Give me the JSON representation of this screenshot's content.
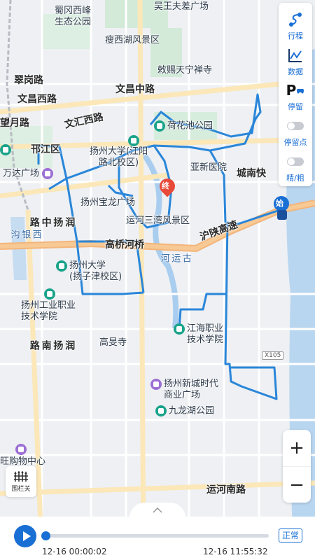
{
  "map": {
    "labels": {
      "shugang": "蜀冈西峰\n生态公园",
      "wuwang": "吴王夫差广场",
      "shouxihu": "瘦西湖风景区",
      "cuigang": "翠岗路",
      "chici": "敕赐天宁禅寺",
      "wenchangxi": "文昌西路",
      "wenchangzhong": "文昌中路",
      "wanghang": "望月路",
      "wenhuixi": "文汇西路",
      "hehuachi": "荷花池公园",
      "hanjiang": "邗江区",
      "yzu_jiangyang": "扬州大学(江阳\n路北校区)",
      "wanda": "万达广场",
      "yaxin": "亚新医院",
      "chengnan": "城南快",
      "baolong": "扬州宝龙广场",
      "yunhe_sanwan": "运河三湾风景区",
      "hushan": "沪陕高速",
      "xiyinyan": "西\n银\n沟",
      "runyang_zhong": "润\n扬\n中\n路",
      "gaoqiao": "高桥河桥",
      "yzu_yangzijin": "扬州大学\n(扬子津校区)",
      "gu_yunhe": "古\n运\n河",
      "yz_vocational": "扬州工业职业\n技术学院",
      "jianghai": "江海职业\n技术学院",
      "gaomin": "高旻寺",
      "runyang_nan": "润\n扬\n南\n路",
      "x105": "X105",
      "xincheng": "扬州新城时代\n商业广场",
      "jiulonghu": "九龙湖公园",
      "wangjuwu": "旺购物中心",
      "yunhe_nan": "运河南路"
    },
    "end_marker": "终",
    "start_marker": "始"
  },
  "right_panel": {
    "items": [
      {
        "label": "行程",
        "icon": "route-icon"
      },
      {
        "label": "数据",
        "icon": "chart-icon"
      },
      {
        "label": "停留",
        "icon": "parking-icon"
      },
      {
        "label": "停留点",
        "icon": "toggle-icon",
        "enabled": false
      },
      {
        "label": "精/粗",
        "icon": "toggle-icon",
        "enabled": false
      }
    ]
  },
  "zoom": {
    "in": "+",
    "out": "−"
  },
  "fence": {
    "label": "围栏关"
  },
  "playback": {
    "start_time": "12-16 00:00:02",
    "end_time": "12-16 11:55:32",
    "speed_label": "正常",
    "progress": 0
  },
  "colors": {
    "route": "#2a86d9",
    "accent": "#1a6fd4",
    "highway": "#f3b57a",
    "water": "#a9cdee",
    "park": "#cfe8d6"
  }
}
